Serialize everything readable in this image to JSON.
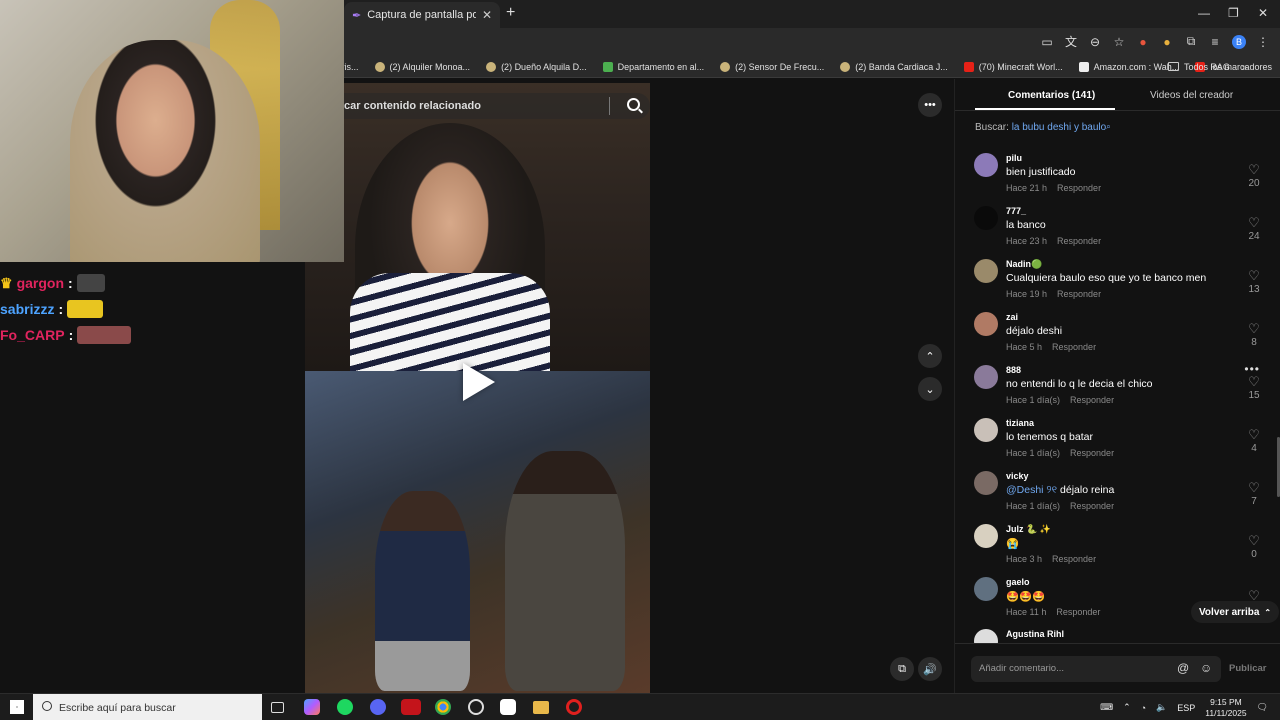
{
  "browser": {
    "tab_title": "Captura de pantalla por Lightshot",
    "new_tab": "+",
    "window_controls": [
      "—",
      "❐",
      "✕"
    ],
    "bookmarks": [
      {
        "label": "vis...",
        "icon": "bookmark-icon"
      },
      {
        "label": "(2) Alquiler Monoa...",
        "icon": "bookmark-icon"
      },
      {
        "label": "(2) Dueño Alquila D...",
        "icon": "bookmark-icon"
      },
      {
        "label": "Departamento en al...",
        "icon": "map-icon"
      },
      {
        "label": "(2) Sensor De Frecu...",
        "icon": "bookmark-icon"
      },
      {
        "label": "(2) Banda Cardiaca J...",
        "icon": "bookmark-icon"
      },
      {
        "label": "(70) Minecraft Worl...",
        "icon": "youtube-icon"
      },
      {
        "label": "Amazon.com : Wah...",
        "icon": "amazon-icon"
      },
      {
        "label": "RAG",
        "icon": "youtube-icon"
      }
    ],
    "bookmarks_more": "»",
    "all_bookmarks": "Todos los marcadores",
    "profile_initial": "B"
  },
  "video": {
    "search_placeholder": "Buscar contenido relacionado",
    "search_visible": "car contenido relacionado"
  },
  "chat": [
    {
      "user": "gargon",
      "color": "#e0245e",
      "badge": "crown"
    },
    {
      "user": "sabrizzz",
      "color": "#4da3ff",
      "badge": ""
    },
    {
      "user": "Fo_CARP",
      "color": "#e0245e",
      "badge": ""
    }
  ],
  "panel": {
    "tab_comments": "Comentarios (141)",
    "tab_creator": "Videos del creador",
    "search_label": "Buscar:",
    "search_query": "la bubu deshi y baulo",
    "reply_label": "Responder",
    "back_to_top": "Volver arriba",
    "add_comment_placeholder": "Añadir comentario...",
    "publish": "Publicar"
  },
  "comments": [
    {
      "user": "pilu",
      "text": "bien justificado",
      "time": "Hace 21 h",
      "likes": "20",
      "avatar_color": "#8c7ab8"
    },
    {
      "user": "777_",
      "text": "la banco",
      "time": "Hace 23 h",
      "likes": "24",
      "avatar_color": "#111111"
    },
    {
      "user": "Nadin🟢",
      "text": "Cualquiera baulo eso que yo te banco men",
      "time": "Hace 19 h",
      "likes": "13",
      "avatar_color": "#9a8a6a"
    },
    {
      "user": "zai",
      "text": "déjalo deshi",
      "time": "Hace 5 h",
      "likes": "8",
      "avatar_color": "#b07a64"
    },
    {
      "user": "888",
      "text": "no entendi lo q le decia el chico",
      "time": "Hace 1 día(s)",
      "likes": "15",
      "avatar_color": "#8a7a9a"
    },
    {
      "user": "tiziana",
      "text": "lo tenemos q batar",
      "time": "Hace 1 día(s)",
      "likes": "4",
      "avatar_color": "#c9c0b8"
    },
    {
      "user": "vicky",
      "mention": "@Deshi ୨୧",
      "text": " déjalo reina",
      "time": "Hace 1 día(s)",
      "likes": "7",
      "avatar_color": "#7a6a64"
    },
    {
      "user": "Julz 🐍 ✨",
      "text": "😭",
      "time": "Hace 3 h",
      "likes": "0",
      "avatar_color": "#d8d0c0"
    },
    {
      "user": "gaelo",
      "text": "🤩🤩🤩",
      "time": "Hace 11 h",
      "likes": "",
      "avatar_color": "#607080"
    },
    {
      "user": "Agustina Rihl",
      "text": "",
      "time": "",
      "likes": "",
      "avatar_color": "#ddd"
    }
  ],
  "taskbar": {
    "search_placeholder": "Escribe aquí para buscar",
    "language": "ESP",
    "time": "9:15 PM",
    "date": "11/11/2025"
  }
}
